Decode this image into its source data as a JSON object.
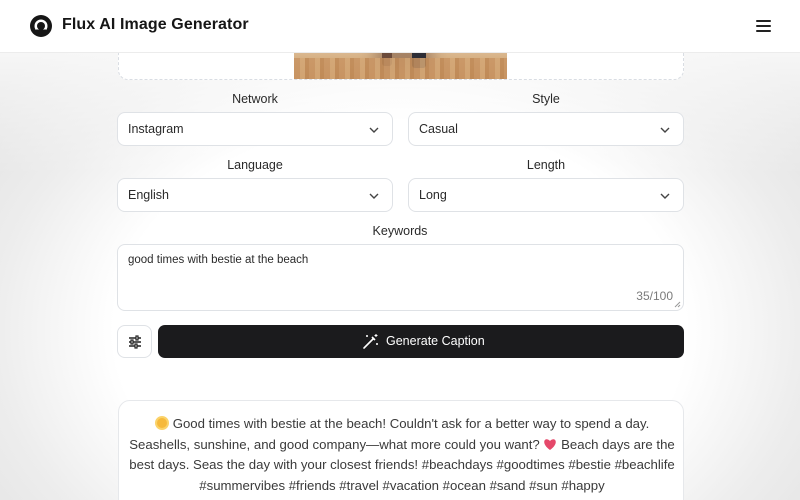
{
  "header": {
    "brand": "Flux AI Image Generator",
    "logo_icon": "flux-logo-icon",
    "menu_icon": "hamburger-menu-icon"
  },
  "upload": {
    "image_alt": "beach photo preview"
  },
  "form": {
    "network": {
      "label": "Network",
      "value": "Instagram"
    },
    "style": {
      "label": "Style",
      "value": "Casual"
    },
    "language": {
      "label": "Language",
      "value": "English"
    },
    "length": {
      "label": "Length",
      "value": "Long"
    },
    "keywords": {
      "label": "Keywords",
      "value": "good times with bestie at the beach",
      "counter": "35/100"
    }
  },
  "actions": {
    "options_icon": "sliders-icon",
    "generate_label": "Generate Caption",
    "generate_icon": "magic-wand-icon"
  },
  "result": {
    "part1": "Good times with bestie at the beach! Couldn't ask for a better way to spend a day. Seashells, sunshine, and good company—what more could you want?",
    "part2": "Beach days are the best days. Seas the day with your closest friends! #beachdays #goodtimes #bestie #beachlife #summervibes #friends #travel #vacation #ocean #sand #sun #happy",
    "emoji1": "sun-emoji",
    "emoji2": "heart-emoji"
  },
  "colors": {
    "button_bg": "#1b1b1d",
    "border": "#dfe2e6",
    "accent_heart": "#e5486a",
    "sun": "#f6b93b"
  }
}
